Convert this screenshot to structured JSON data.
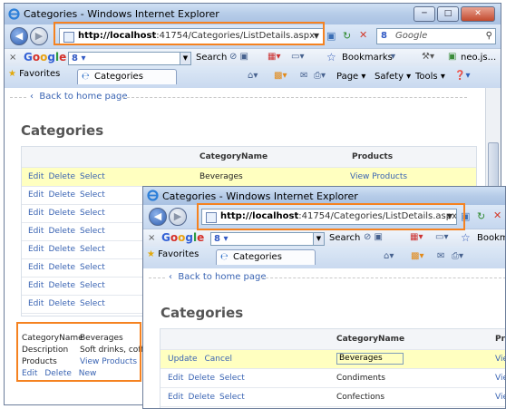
{
  "window1": {
    "title": "Categories - Windows Internet Explorer",
    "address_host": "http://localhost",
    "address_rest": ":41754/Categories/ListDetails.aspx",
    "search_placeholder": "Google",
    "toolbar": {
      "search": "Search",
      "bookmarks": "Bookmarks",
      "neo": "neo.js..."
    },
    "favorites": "Favorites",
    "tab": "Categories",
    "command": {
      "page": "Page",
      "safety": "Safety",
      "tools": "Tools"
    },
    "back_link": "Back to home page",
    "heading": "Categories",
    "columns": [
      "",
      "CategoryName",
      "Products"
    ],
    "rows": [
      {
        "actions": [
          "Edit",
          "Delete",
          "Select"
        ],
        "name": "Beverages",
        "products": "View Products",
        "selected": true
      },
      {
        "actions": [
          "Edit",
          "Delete",
          "Select"
        ],
        "name": "",
        "products": ""
      },
      {
        "actions": [
          "Edit",
          "Delete",
          "Select"
        ],
        "name": "",
        "products": ""
      },
      {
        "actions": [
          "Edit",
          "Delete",
          "Select"
        ],
        "name": "",
        "products": ""
      },
      {
        "actions": [
          "Edit",
          "Delete",
          "Select"
        ],
        "name": "",
        "products": ""
      },
      {
        "actions": [
          "Edit",
          "Delete",
          "Select"
        ],
        "name": "",
        "products": ""
      },
      {
        "actions": [
          "Edit",
          "Delete",
          "Select"
        ],
        "name": "",
        "products": ""
      },
      {
        "actions": [
          "Edit",
          "Delete",
          "Select"
        ],
        "name": "",
        "products": ""
      }
    ],
    "details": {
      "category_label": "CategoryName",
      "category_value": "Beverages",
      "description_label": "Description",
      "description_value": "Soft drinks, coffees",
      "products_label": "Products",
      "products_value": "View Products",
      "actions": [
        "Edit",
        "Delete",
        "New"
      ]
    }
  },
  "window2": {
    "title": "Categories - Windows Internet Explorer",
    "address_host": "http://localhost",
    "address_rest": ":41754/Categories/ListDetails.aspx",
    "toolbar": {
      "search": "Search",
      "bookmarks": "Bookmarks"
    },
    "favorites": "Favorites",
    "tab": "Categories",
    "back_link": "Back to home page",
    "heading": "Categories",
    "columns": [
      "",
      "CategoryName",
      "Pr"
    ],
    "edit_row": {
      "actions": [
        "Update",
        "Cancel"
      ],
      "value": "Beverages",
      "products": "View"
    },
    "rows": [
      {
        "actions": [
          "Edit",
          "Delete",
          "Select"
        ],
        "name": "Condiments",
        "products": "View"
      },
      {
        "actions": [
          "Edit",
          "Delete",
          "Select"
        ],
        "name": "Confections",
        "products": "View"
      }
    ]
  },
  "colors": {
    "highlight": "#f58220",
    "selected_row": "#ffffc0",
    "link": "#3a64b3"
  }
}
